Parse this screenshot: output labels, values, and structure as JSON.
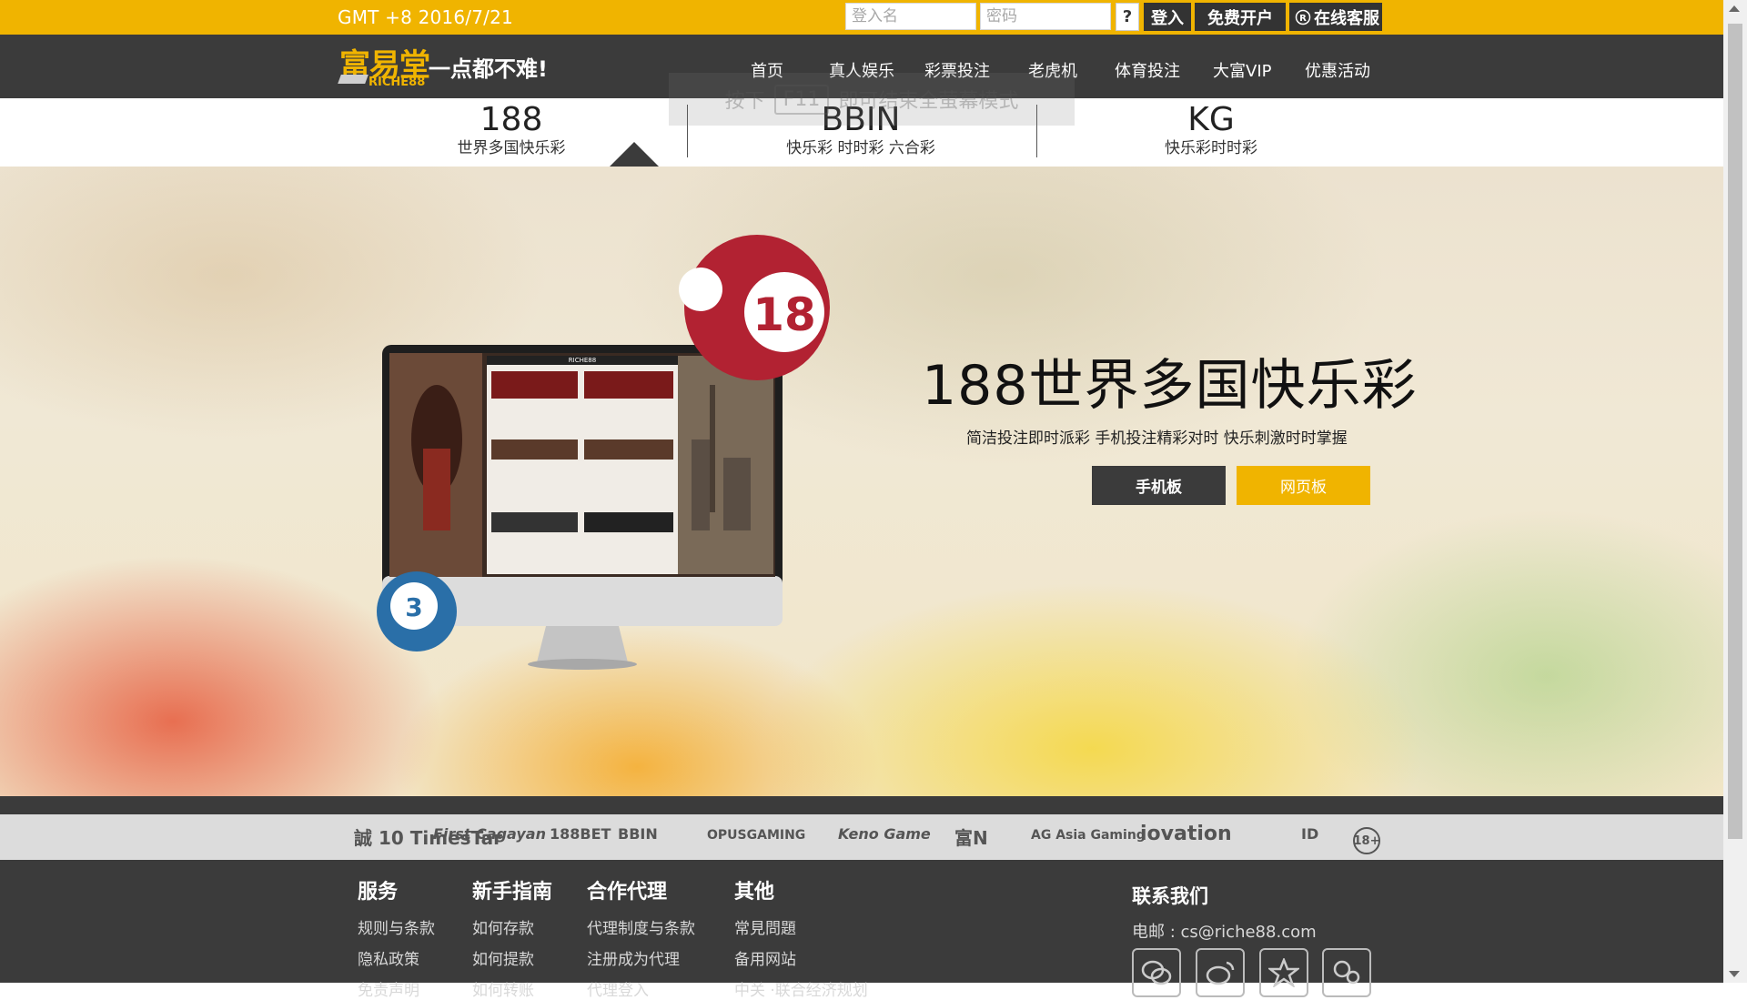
{
  "topbar": {
    "datetime": "GMT +8 2016/7/21",
    "username_placeholder": "登入名",
    "password_placeholder": "密码",
    "help_label": "?",
    "login_label": "登入",
    "register_label": "免费开户",
    "support_label": "在线客服",
    "color": "#f0b400"
  },
  "brand": {
    "name_cn": "富易堂",
    "name_en": "RICHE88",
    "slogan": "一点都不难!"
  },
  "nav": {
    "items": [
      "首页",
      "真人娱乐",
      "彩票投注",
      "老虎机",
      "体育投注",
      "大富VIP",
      "优惠活动"
    ]
  },
  "fullscreen_hint": {
    "prefix": "按下",
    "key": "F11",
    "suffix": "即可结束全萤幕模式"
  },
  "tabs": [
    {
      "title": "188",
      "subtitle": "世界多国快乐彩",
      "active": true
    },
    {
      "title": "BBIN",
      "subtitle": "快乐彩 时时彩 六合彩",
      "active": false
    },
    {
      "title": "KG",
      "subtitle": "快乐彩时时彩",
      "active": false
    }
  ],
  "hero": {
    "title": "188世界多国快乐彩",
    "subtitle": "简洁投注即时派彩 手机投注精彩对时 快乐刺激时时掌握",
    "mobile_button": "手机板",
    "web_button": "网页板",
    "ball_big": "18",
    "ball_small": "3",
    "screen_brand": "RICHE88"
  },
  "partners": [
    "誠 10 TimesTar",
    "First Cagayan",
    "188BET",
    "BBIN",
    "OPUSGAMING",
    "Keno Game",
    "富N",
    "AG Asia Gaming",
    "iovation",
    "ID",
    "18+"
  ],
  "footer": {
    "columns": [
      {
        "heading": "服务",
        "links": [
          "规则与条款",
          "隐私政策",
          "免责声明"
        ]
      },
      {
        "heading": "新手指南",
        "links": [
          "如何存款",
          "如何提款",
          "如何转账"
        ]
      },
      {
        "heading": "合作代理",
        "links": [
          "代理制度与条款",
          "注册成为代理",
          "代理登入"
        ]
      },
      {
        "heading": "其他",
        "links": [
          "常見問題",
          "备用网站",
          "中关 ·联合经济规划"
        ]
      }
    ],
    "contact_heading": "联系我们",
    "email": "电邮 : cs@riche88.com",
    "social_icons": [
      "wechat-icon",
      "weibo-icon",
      "star-icon",
      "qq-icon"
    ]
  }
}
